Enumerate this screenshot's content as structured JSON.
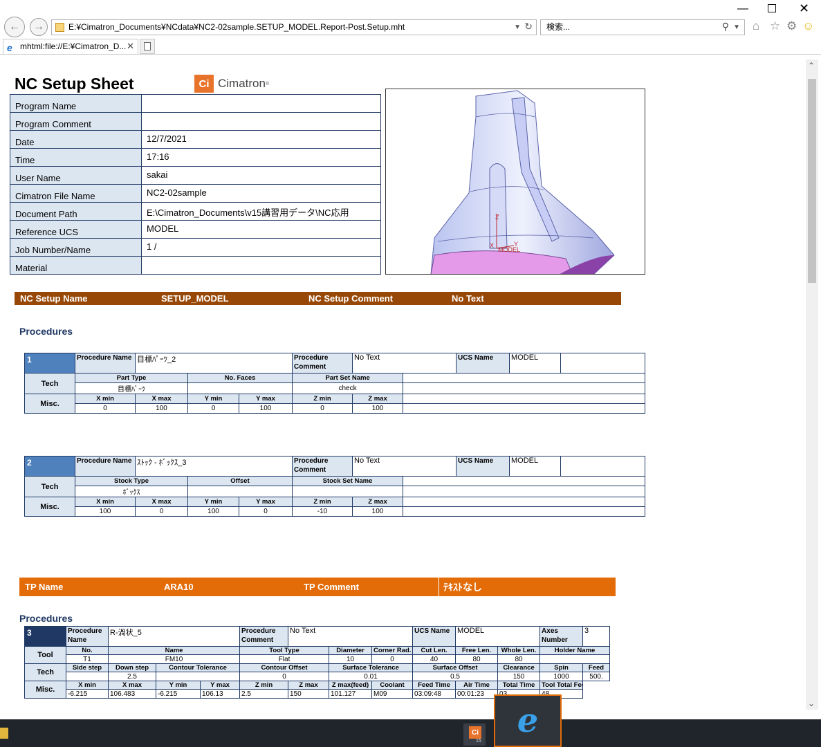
{
  "browser": {
    "address": "E:¥Cimatron_Documents¥NCdata¥NC2-02sample.SETUP_MODEL.Report-Post.Setup.mht",
    "search_placeholder": "検索...",
    "tab_title": "mhtml:file://E:¥Cimatron_D..."
  },
  "page": {
    "title": "NC Setup Sheet",
    "logo_text": "Cimatron",
    "logo_mark": "Ci",
    "info_rows": [
      {
        "label": "Program Name",
        "value": ""
      },
      {
        "label": "Program Comment",
        "value": ""
      },
      {
        "label": "Date",
        "value": "12/7/2021"
      },
      {
        "label": "Time",
        "value": "17:16"
      },
      {
        "label": "User Name",
        "value": "sakai"
      },
      {
        "label": "Cimatron File Name",
        "value": "NC2-02sample"
      },
      {
        "label": "Document Path",
        "value": "E:\\Cimatron_Documents\\v15講習用データ\\NC応用"
      },
      {
        "label": "Reference UCS",
        "value": "MODEL"
      },
      {
        "label": "Job Number/Name",
        "value": "1 /"
      },
      {
        "label": "Material",
        "value": ""
      }
    ],
    "preview_labels": {
      "z": "Z",
      "model": "MODEL",
      "x": "X",
      "y": "Y"
    },
    "setup_bar": {
      "name_label": "NC Setup Name",
      "name_value": "SETUP_MODEL",
      "comment_label": "NC Setup Comment",
      "comment_value": "No Text"
    },
    "procedures_heading": "Procedures",
    "procedures_heading2": "Procedures",
    "tp_bar": {
      "name_label": "TP Name",
      "name_value": "ARA10",
      "comment_label": "TP Comment",
      "comment_value": "ﾃｷｽﾄなし"
    },
    "proc1": {
      "num": "1",
      "pname_label": "Procedure Name",
      "pname": "目標ﾊﾟｰﾂ_2",
      "pcomment_label": "Procedure Comment",
      "pcomment": "No Text",
      "ucs_label": "UCS Name",
      "ucs": "MODEL",
      "tech_label": "Tech",
      "misc_label": "Misc.",
      "tech_headers": [
        "Part Type",
        "No. Faces",
        "Part Set Name"
      ],
      "tech_values": [
        "目標ﾊﾟｰﾂ",
        "",
        "check"
      ],
      "misc_headers": [
        "X min",
        "X max",
        "Y min",
        "Y max",
        "Z min",
        "Z max"
      ],
      "misc_values": [
        "0",
        "100",
        "0",
        "100",
        "0",
        "100"
      ]
    },
    "proc2": {
      "num": "2",
      "pname_label": "Procedure Name",
      "pname": "ｽﾄｯｸ - ﾎﾞｯｸｽ_3",
      "pcomment_label": "Procedure Comment",
      "pcomment": "No Text",
      "ucs_label": "UCS Name",
      "ucs": "MODEL",
      "tech_label": "Tech",
      "misc_label": "Misc.",
      "tech_headers": [
        "Stock Type",
        "Offset",
        "Stock Set Name"
      ],
      "tech_values": [
        "ﾎﾞｯｸｽ",
        "",
        ""
      ],
      "misc_headers": [
        "X min",
        "X max",
        "Y min",
        "Y max",
        "Z min",
        "Z max"
      ],
      "misc_values": [
        "100",
        "0",
        "100",
        "0",
        "-10",
        "100"
      ]
    },
    "proc3": {
      "num": "3",
      "pname_label": "Procedure Name",
      "pname": "R-渦状_5",
      "pcomment_label": "Procedure Comment",
      "pcomment": "No Text",
      "ucs_label": "UCS Name",
      "ucs": "MODEL",
      "axes_label": "Axes Number",
      "axes": "3",
      "tool_label": "Tool",
      "tech_label": "Tech",
      "misc_label": "Misc.",
      "tool_headers": [
        "No.",
        "Name",
        "Tool Type",
        "Diameter",
        "Corner Rad.",
        "Cut Len.",
        "Free Len.",
        "Whole Len.",
        "Holder Name"
      ],
      "tool_values": [
        "T1",
        "FM10",
        "Flat",
        "10",
        "0",
        "40",
        "80",
        "80",
        ""
      ],
      "tech_headers": [
        "Side step",
        "Down step",
        "Contour Tolerance",
        "Contour Offset",
        "Surface Tolerance",
        "Surface Offset",
        "Clearance",
        "Spin",
        "Feed"
      ],
      "tech_values": [
        "",
        "2.5",
        "",
        "0",
        "0.01",
        "0.5",
        "150",
        "1000",
        "500."
      ],
      "misc_headers": [
        "X min",
        "X max",
        "Y min",
        "Y max",
        "Z min",
        "Z max",
        "Z max(feed)",
        "Coolant",
        "Feed Time",
        "Air Time",
        "Total Time",
        "Tool Total Feed Time"
      ],
      "misc_values": [
        "-6.215",
        "106.483",
        "-6.215",
        "106.13",
        "2.5",
        "150",
        "101.127",
        "M09",
        "03:09:48",
        "00:01:23",
        "03",
        "48"
      ]
    }
  },
  "taskbar": {
    "cimatron_badge": "15",
    "cimatron_mark": "Ci",
    "ie_glyph": "e"
  }
}
